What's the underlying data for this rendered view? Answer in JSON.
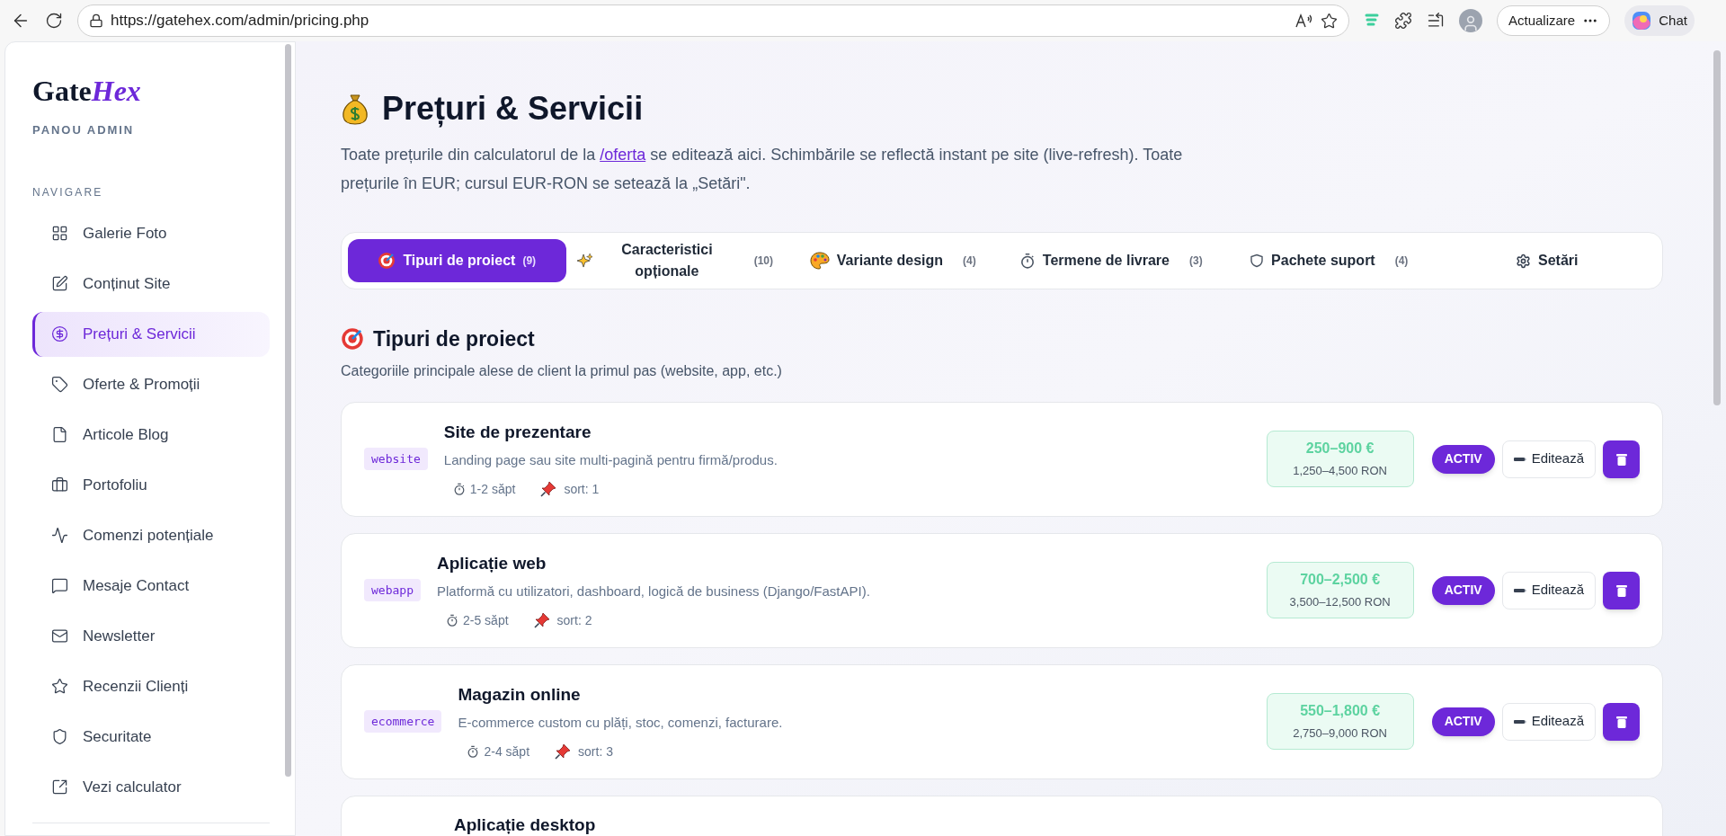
{
  "browser": {
    "url": "https://gatehex.com/admin/pricing.php",
    "update_button": "Actualizare",
    "chat_button": "Chat"
  },
  "sidebar": {
    "logo_plain": "Gate",
    "logo_accent": "Hex",
    "subtitle": "PANOU ADMIN",
    "section_label": "NAVIGARE",
    "items": [
      {
        "label": "Galerie Foto",
        "selected": false
      },
      {
        "label": "Conținut Site",
        "selected": false
      },
      {
        "label": "Prețuri & Servicii",
        "selected": true
      },
      {
        "label": "Oferte & Promoții",
        "selected": false
      },
      {
        "label": "Articole Blog",
        "selected": false
      },
      {
        "label": "Portofoliu",
        "selected": false
      },
      {
        "label": "Comenzi potențiale",
        "selected": false
      },
      {
        "label": "Mesaje Contact",
        "selected": false
      },
      {
        "label": "Newsletter",
        "selected": false
      },
      {
        "label": "Recenzii Clienți",
        "selected": false
      },
      {
        "label": "Securitate",
        "selected": false
      },
      {
        "label": "Vezi calculator",
        "selected": false
      }
    ]
  },
  "page": {
    "title": "Prețuri & Servicii",
    "description_before": "Toate prețurile din calculatorul de la",
    "description_link": "/oferta",
    "description_after": "se editează aici. Schimbările se reflectă instant pe site (live-refresh). Toate prețurile în EUR; cursul EUR-RON se setează la „Setări\"."
  },
  "tabs": [
    {
      "label": "Tipuri de proiect",
      "count": "(9)",
      "selected": true
    },
    {
      "label": "Caracteristici opționale",
      "count": "(10)",
      "selected": false
    },
    {
      "label": "Variante design",
      "count": "(4)",
      "selected": false
    },
    {
      "label": "Termene de livrare",
      "count": "(3)",
      "selected": false
    },
    {
      "label": "Pachete suport",
      "count": "(4)",
      "selected": false
    },
    {
      "label": "Setări",
      "selected": false
    }
  ],
  "section": {
    "title": "Tipuri de proiect",
    "subtitle": "Categoriile principale alese de client la primul pas (website, app, etc.)"
  },
  "projects": [
    {
      "slug": "website",
      "name": "Site de prezentare",
      "description": "Landing page sau site multi-pagină pentru firmă/produs.",
      "duration": "1-2 săpt",
      "sort": "sort: 1",
      "price_eur": "250–900 €",
      "price_ron": "1,250–4,500 RON",
      "status": "ACTIV",
      "active": true,
      "edit_label": "Editează"
    },
    {
      "slug": "webapp",
      "name": "Aplicație web",
      "description": "Platformă cu utilizatori, dashboard, logică de business (Django/FastAPI).",
      "duration": "2-5 săpt",
      "sort": "sort: 2",
      "price_eur": "700–2,500 €",
      "price_ron": "3,500–12,500 RON",
      "status": "ACTIV",
      "active": true,
      "edit_label": "Editează"
    },
    {
      "slug": "ecommerce",
      "name": "Magazin online",
      "description": "E-commerce custom cu plăți, stoc, comenzi, facturare.",
      "duration": "2-4 săpt",
      "sort": "sort: 3",
      "price_eur": "550–1,800 €",
      "price_ron": "2,750–9,000 RON",
      "status": "ACTIV",
      "active": true,
      "edit_label": "Editează"
    },
    {
      "name": "Aplicație desktop"
    }
  ]
}
